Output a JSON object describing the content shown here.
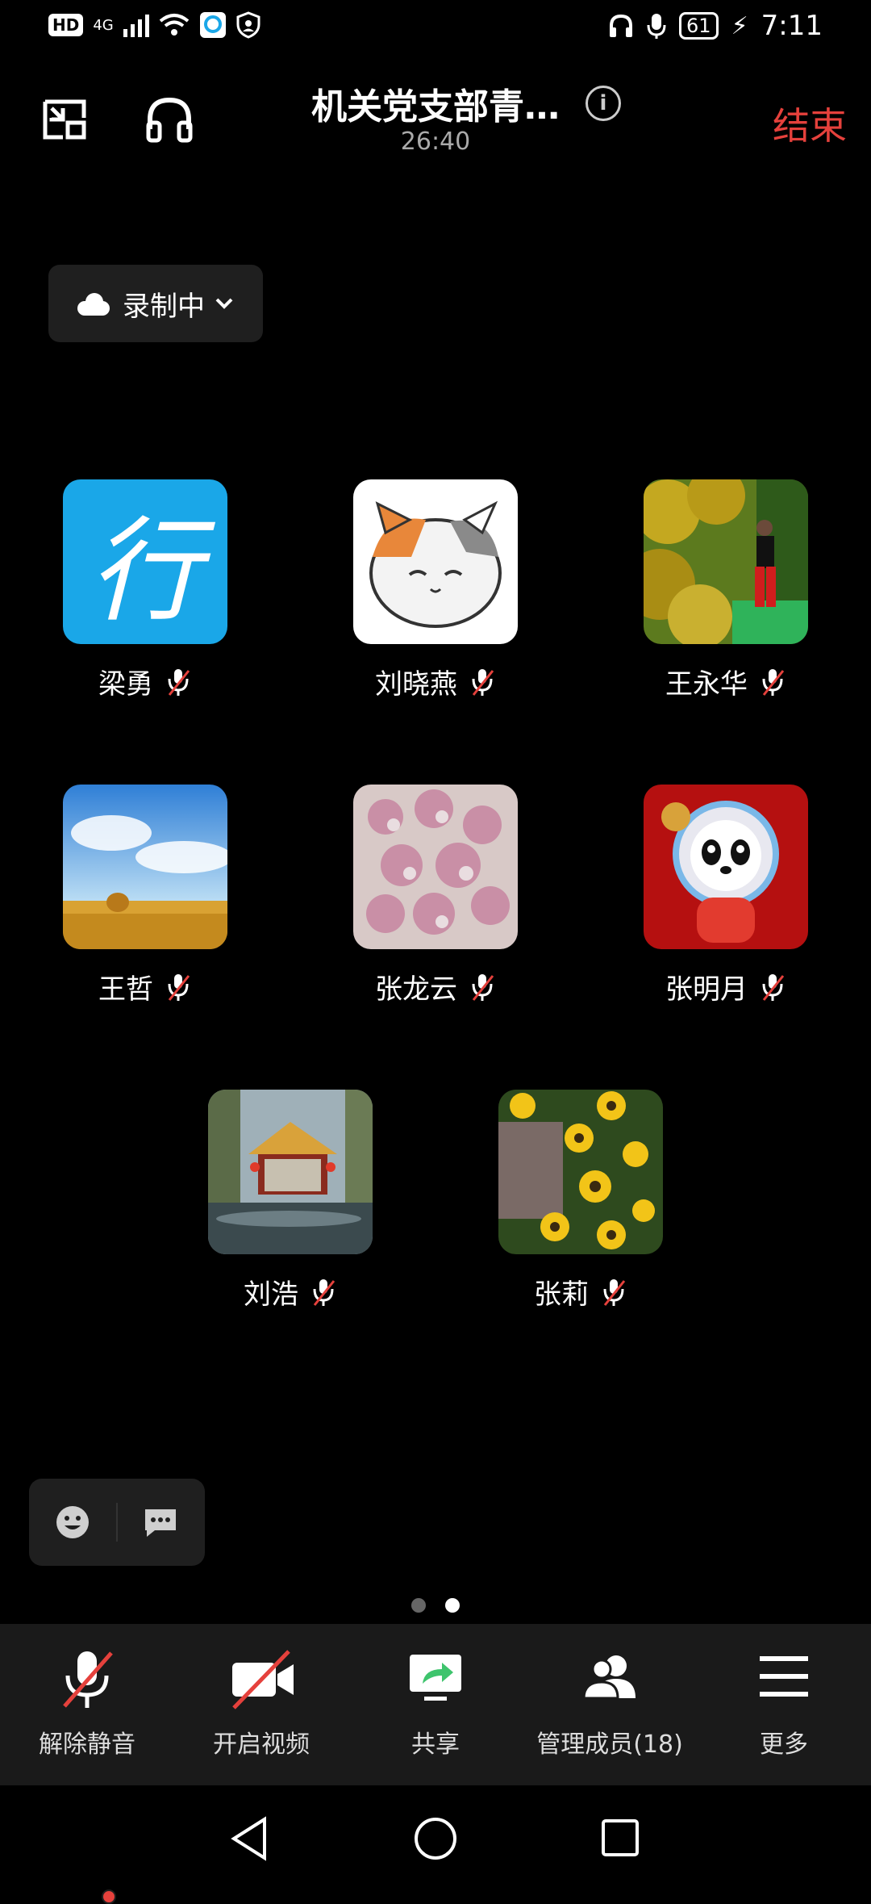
{
  "status_bar": {
    "hd": "HD",
    "network": "4G",
    "battery": "61",
    "time": "7:11"
  },
  "header": {
    "title": "机关党支部青…",
    "duration": "26:40",
    "end_label": "结束"
  },
  "recording": {
    "label": "录制中"
  },
  "participants": [
    {
      "name": "梁勇",
      "avatar": "blue-app-logo",
      "muted": true
    },
    {
      "name": "刘晓燕",
      "avatar": "cat-cartoon",
      "muted": true
    },
    {
      "name": "王永华",
      "avatar": "person-garden-photo",
      "muted": true
    },
    {
      "name": "王哲",
      "avatar": "wheat-field-sky-photo",
      "muted": true
    },
    {
      "name": "张龙云",
      "avatar": "pink-flowers-photo",
      "muted": true
    },
    {
      "name": "张明月",
      "avatar": "panda-mascot-photo",
      "muted": true
    },
    {
      "name": "刘浩",
      "avatar": "pavilion-photo",
      "muted": true
    },
    {
      "name": "张莉",
      "avatar": "yellow-flowers-photo",
      "muted": true
    }
  ],
  "avatar_logo_char": "行",
  "pagination": {
    "current": 2,
    "total": 2
  },
  "toolbar": {
    "unmute": "解除静音",
    "start_video": "开启视频",
    "share": "共享",
    "manage_members": "管理成员(18)",
    "more": "更多"
  },
  "colors": {
    "end": "#e5413c",
    "accent_blue": "#1aa7e8",
    "share_green": "#3ec46d"
  }
}
